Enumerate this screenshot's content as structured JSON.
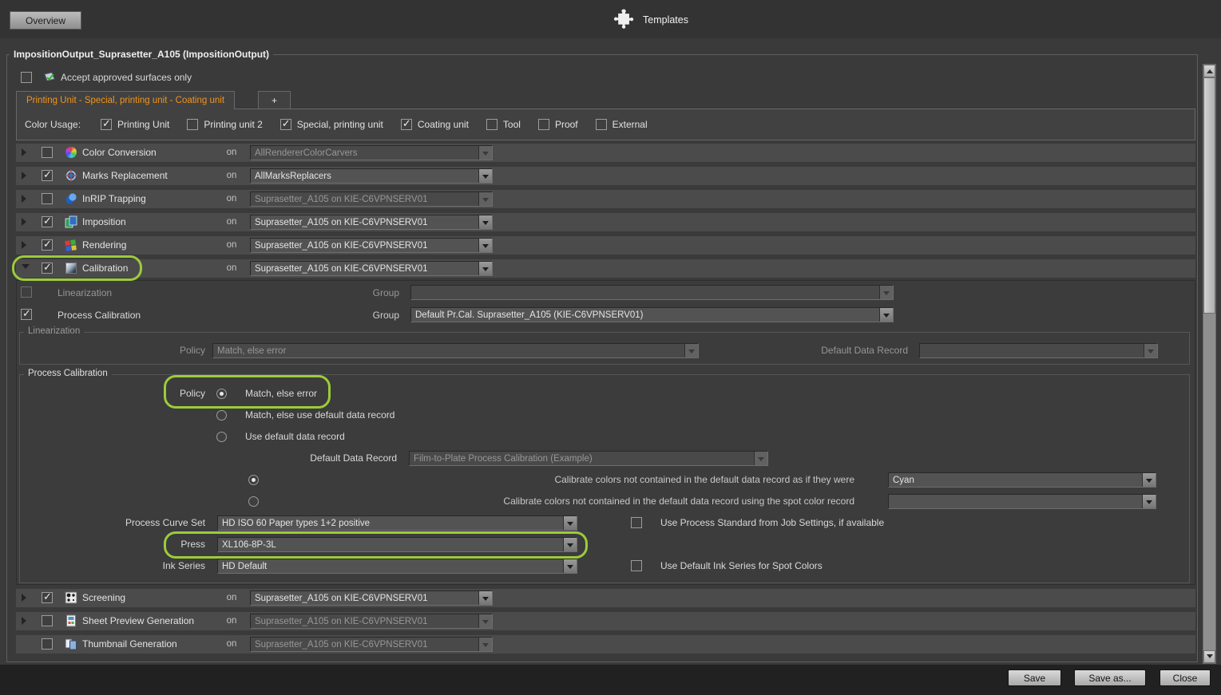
{
  "header": {
    "overview_button": "Overview",
    "templates_label": "Templates"
  },
  "panel": {
    "title": "ImpositionOutput_Suprasetter_A105 (ImpositionOutput)",
    "accept_approved_label": "Accept approved surfaces only",
    "accept_approved_checked": false
  },
  "tabs": {
    "active_tab": "Printing Unit  -  Special, printing unit  -  Coating unit",
    "add_tab": "+"
  },
  "color_usage": {
    "label": "Color Usage:",
    "options": [
      {
        "label": "Printing Unit",
        "checked": true
      },
      {
        "label": "Printing unit 2",
        "checked": false
      },
      {
        "label": "Special, printing unit",
        "checked": true
      },
      {
        "label": "Coating unit",
        "checked": true
      },
      {
        "label": "Tool",
        "checked": false
      },
      {
        "label": "Proof",
        "checked": false
      },
      {
        "label": "External",
        "checked": false
      }
    ]
  },
  "labels": {
    "on": "on",
    "group": "Group",
    "policy": "Policy",
    "default_data_record": "Default Data Record"
  },
  "steps": [
    {
      "label": "Color Conversion",
      "value": "AllRendererColorCarvers",
      "checked": false,
      "disabled": true,
      "icon": "color-conversion-icon",
      "expanded": false
    },
    {
      "label": "Marks Replacement",
      "value": "AllMarksReplacers",
      "checked": true,
      "disabled": false,
      "icon": "marks-replacement-icon",
      "expanded": false
    },
    {
      "label": "InRIP Trapping",
      "value": "Suprasetter_A105 on KIE-C6VPNSERV01",
      "checked": false,
      "disabled": true,
      "icon": "inrip-trapping-icon",
      "expanded": false
    },
    {
      "label": "Imposition",
      "value": "Suprasetter_A105 on KIE-C6VPNSERV01",
      "checked": true,
      "disabled": false,
      "icon": "imposition-icon",
      "expanded": false
    },
    {
      "label": "Rendering",
      "value": "Suprasetter_A105 on KIE-C6VPNSERV01",
      "checked": true,
      "disabled": false,
      "icon": "rendering-icon",
      "expanded": false
    },
    {
      "label": "Calibration",
      "value": "Suprasetter_A105 on KIE-C6VPNSERV01",
      "checked": true,
      "disabled": false,
      "icon": "calibration-icon",
      "expanded": true,
      "highlighted": true
    },
    {
      "label": "Screening",
      "value": "Suprasetter_A105 on KIE-C6VPNSERV01",
      "checked": true,
      "disabled": false,
      "icon": "screening-icon",
      "expanded": false
    },
    {
      "label": "Sheet Preview Generation",
      "value": "Suprasetter_A105 on KIE-C6VPNSERV01",
      "checked": false,
      "disabled": true,
      "icon": "sheet-preview-icon",
      "expanded": false
    },
    {
      "label": "Thumbnail Generation",
      "value": "Suprasetter_A105 on KIE-C6VPNSERV01",
      "checked": false,
      "disabled": true,
      "icon": "thumbnail-generation-icon",
      "expanded": false
    }
  ],
  "calibration": {
    "linearization_row": {
      "label": "Linearization",
      "checked": false,
      "disabled": true,
      "group_value": ""
    },
    "process_calibration_row": {
      "label": "Process Calibration",
      "checked": true,
      "disabled": false,
      "group_value": "Default Pr.Cal. Suprasetter_A105 (KIE-C6VPNSERV01)"
    },
    "linearization_box": {
      "title": "Linearization",
      "disabled": true,
      "policy_value": "Match, else error",
      "default_data_record_value": ""
    },
    "process_box": {
      "title": "Process Calibration",
      "policy_options": [
        {
          "label": "Match, else error",
          "selected": true,
          "highlighted": true
        },
        {
          "label": "Match, else use default data record",
          "selected": false
        },
        {
          "label": "Use default data record",
          "selected": false
        }
      ],
      "default_data_record_value": "Film-to-Plate Process Calibration (Example)",
      "default_data_record_disabled": true,
      "calibrate_default_label": "Calibrate colors not contained in the default data record as if they were",
      "calibrate_default_selected": true,
      "calibrate_default_value": "Cyan",
      "calibrate_spot_label": "Calibrate colors not contained in the default data record using the spot color record",
      "calibrate_spot_selected": false,
      "calibrate_spot_value": "",
      "process_curve_set_label": "Process Curve Set",
      "process_curve_set_value": "HD ISO 60 Paper types 1+2 positive",
      "use_process_standard_label": "Use Process Standard from Job Settings, if available",
      "use_process_standard_checked": false,
      "press_label": "Press",
      "press_value": "XL106-8P-3L",
      "press_highlighted": true,
      "ink_series_label": "Ink Series",
      "ink_series_value": "HD Default",
      "use_default_ink_label": "Use Default Ink Series for Spot Colors",
      "use_default_ink_checked": false
    }
  },
  "footer": {
    "save": "Save",
    "save_as": "Save as...",
    "close": "Close"
  },
  "colors": {
    "highlight_green": "#9ccb3c",
    "tab_orange": "#f0941e",
    "row_bg": "#4b4b4b"
  }
}
